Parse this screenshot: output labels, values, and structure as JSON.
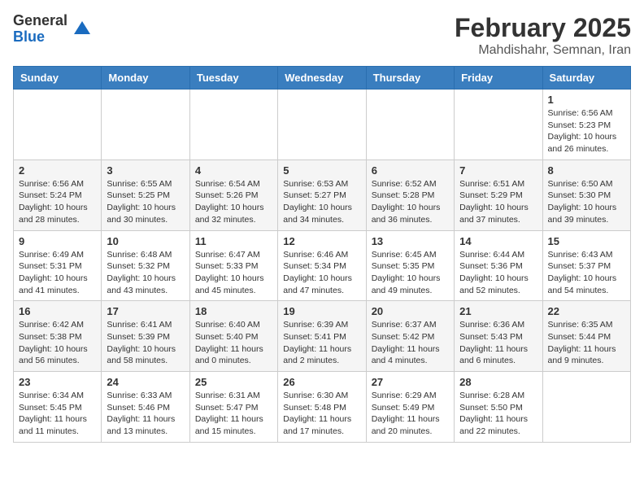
{
  "header": {
    "logo_general": "General",
    "logo_blue": "Blue",
    "month_title": "February 2025",
    "location": "Mahdishahr, Semnan, Iran"
  },
  "weekdays": [
    "Sunday",
    "Monday",
    "Tuesday",
    "Wednesday",
    "Thursday",
    "Friday",
    "Saturday"
  ],
  "weeks": [
    [
      {
        "day": "",
        "info": ""
      },
      {
        "day": "",
        "info": ""
      },
      {
        "day": "",
        "info": ""
      },
      {
        "day": "",
        "info": ""
      },
      {
        "day": "",
        "info": ""
      },
      {
        "day": "",
        "info": ""
      },
      {
        "day": "1",
        "info": "Sunrise: 6:56 AM\nSunset: 5:23 PM\nDaylight: 10 hours and 26 minutes."
      }
    ],
    [
      {
        "day": "2",
        "info": "Sunrise: 6:56 AM\nSunset: 5:24 PM\nDaylight: 10 hours and 28 minutes."
      },
      {
        "day": "3",
        "info": "Sunrise: 6:55 AM\nSunset: 5:25 PM\nDaylight: 10 hours and 30 minutes."
      },
      {
        "day": "4",
        "info": "Sunrise: 6:54 AM\nSunset: 5:26 PM\nDaylight: 10 hours and 32 minutes."
      },
      {
        "day": "5",
        "info": "Sunrise: 6:53 AM\nSunset: 5:27 PM\nDaylight: 10 hours and 34 minutes."
      },
      {
        "day": "6",
        "info": "Sunrise: 6:52 AM\nSunset: 5:28 PM\nDaylight: 10 hours and 36 minutes."
      },
      {
        "day": "7",
        "info": "Sunrise: 6:51 AM\nSunset: 5:29 PM\nDaylight: 10 hours and 37 minutes."
      },
      {
        "day": "8",
        "info": "Sunrise: 6:50 AM\nSunset: 5:30 PM\nDaylight: 10 hours and 39 minutes."
      }
    ],
    [
      {
        "day": "9",
        "info": "Sunrise: 6:49 AM\nSunset: 5:31 PM\nDaylight: 10 hours and 41 minutes."
      },
      {
        "day": "10",
        "info": "Sunrise: 6:48 AM\nSunset: 5:32 PM\nDaylight: 10 hours and 43 minutes."
      },
      {
        "day": "11",
        "info": "Sunrise: 6:47 AM\nSunset: 5:33 PM\nDaylight: 10 hours and 45 minutes."
      },
      {
        "day": "12",
        "info": "Sunrise: 6:46 AM\nSunset: 5:34 PM\nDaylight: 10 hours and 47 minutes."
      },
      {
        "day": "13",
        "info": "Sunrise: 6:45 AM\nSunset: 5:35 PM\nDaylight: 10 hours and 49 minutes."
      },
      {
        "day": "14",
        "info": "Sunrise: 6:44 AM\nSunset: 5:36 PM\nDaylight: 10 hours and 52 minutes."
      },
      {
        "day": "15",
        "info": "Sunrise: 6:43 AM\nSunset: 5:37 PM\nDaylight: 10 hours and 54 minutes."
      }
    ],
    [
      {
        "day": "16",
        "info": "Sunrise: 6:42 AM\nSunset: 5:38 PM\nDaylight: 10 hours and 56 minutes."
      },
      {
        "day": "17",
        "info": "Sunrise: 6:41 AM\nSunset: 5:39 PM\nDaylight: 10 hours and 58 minutes."
      },
      {
        "day": "18",
        "info": "Sunrise: 6:40 AM\nSunset: 5:40 PM\nDaylight: 11 hours and 0 minutes."
      },
      {
        "day": "19",
        "info": "Sunrise: 6:39 AM\nSunset: 5:41 PM\nDaylight: 11 hours and 2 minutes."
      },
      {
        "day": "20",
        "info": "Sunrise: 6:37 AM\nSunset: 5:42 PM\nDaylight: 11 hours and 4 minutes."
      },
      {
        "day": "21",
        "info": "Sunrise: 6:36 AM\nSunset: 5:43 PM\nDaylight: 11 hours and 6 minutes."
      },
      {
        "day": "22",
        "info": "Sunrise: 6:35 AM\nSunset: 5:44 PM\nDaylight: 11 hours and 9 minutes."
      }
    ],
    [
      {
        "day": "23",
        "info": "Sunrise: 6:34 AM\nSunset: 5:45 PM\nDaylight: 11 hours and 11 minutes."
      },
      {
        "day": "24",
        "info": "Sunrise: 6:33 AM\nSunset: 5:46 PM\nDaylight: 11 hours and 13 minutes."
      },
      {
        "day": "25",
        "info": "Sunrise: 6:31 AM\nSunset: 5:47 PM\nDaylight: 11 hours and 15 minutes."
      },
      {
        "day": "26",
        "info": "Sunrise: 6:30 AM\nSunset: 5:48 PM\nDaylight: 11 hours and 17 minutes."
      },
      {
        "day": "27",
        "info": "Sunrise: 6:29 AM\nSunset: 5:49 PM\nDaylight: 11 hours and 20 minutes."
      },
      {
        "day": "28",
        "info": "Sunrise: 6:28 AM\nSunset: 5:50 PM\nDaylight: 11 hours and 22 minutes."
      },
      {
        "day": "",
        "info": ""
      }
    ]
  ]
}
